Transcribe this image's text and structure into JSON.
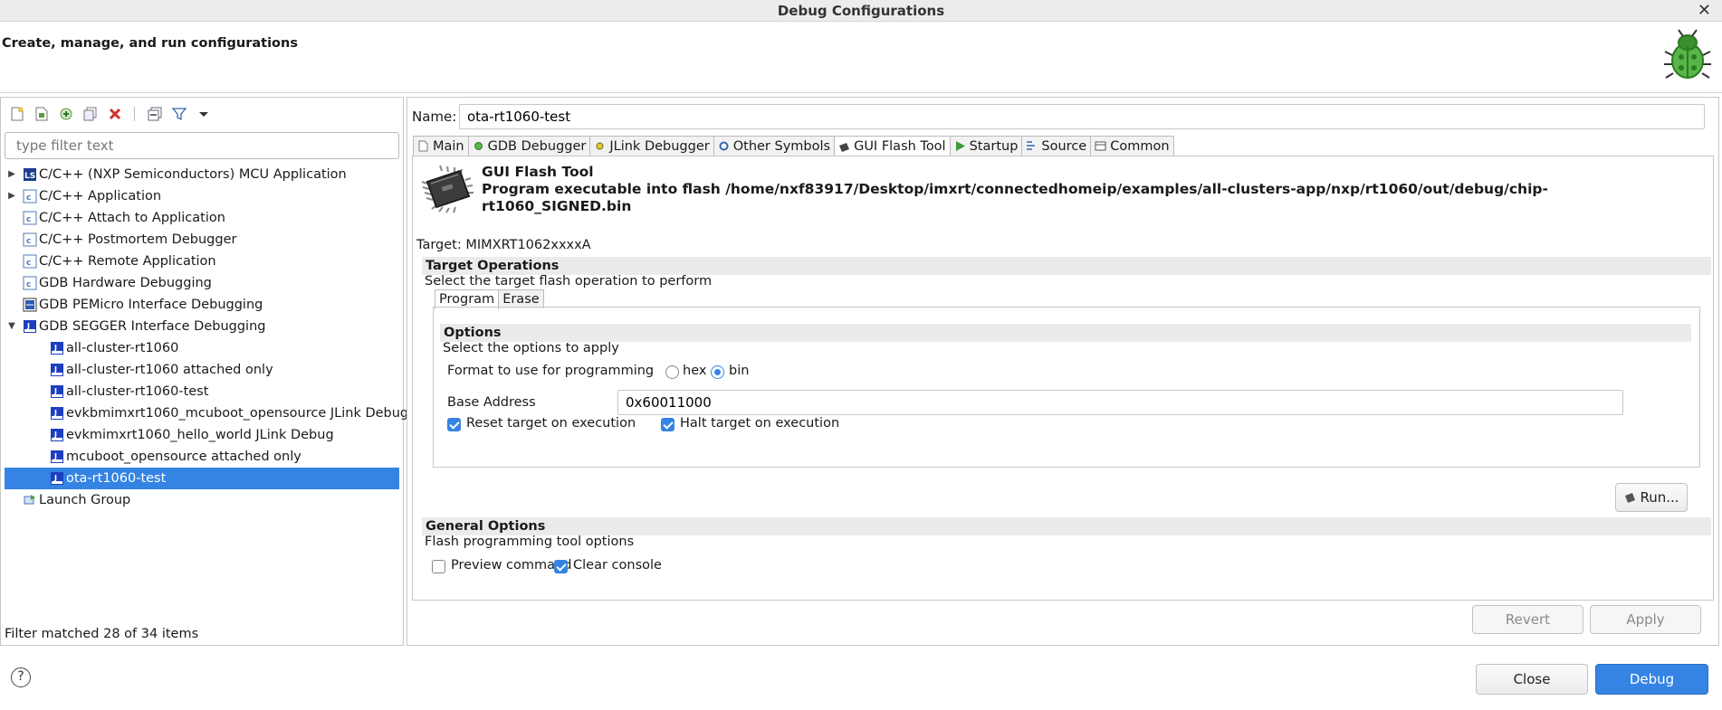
{
  "window": {
    "title": "Debug Configurations",
    "close_glyph": "✕"
  },
  "header": {
    "subtitle": "Create, manage, and run configurations",
    "icon": "bug-icon"
  },
  "left_panel": {
    "toolbar": [
      "new-configuration-icon",
      "new-prototype-icon",
      "export-icon",
      "duplicate-icon",
      "delete-icon",
      "collapse-all-icon",
      "filter-icon",
      "view-menu-icon"
    ],
    "filter_placeholder": "type filter text",
    "tree": [
      {
        "label": "C/C++ (NXP Semiconductors) MCU Application",
        "level": 0,
        "twisty": "▶",
        "icon": "ls"
      },
      {
        "label": "C/C++ Application",
        "level": 0,
        "twisty": "▶",
        "icon": "c"
      },
      {
        "label": "C/C++ Attach to Application",
        "level": 0,
        "twisty": "",
        "icon": "c"
      },
      {
        "label": "C/C++ Postmortem Debugger",
        "level": 0,
        "twisty": "",
        "icon": "c"
      },
      {
        "label": "C/C++ Remote Application",
        "level": 0,
        "twisty": "",
        "icon": "c"
      },
      {
        "label": "GDB Hardware Debugging",
        "level": 0,
        "twisty": "",
        "icon": "c"
      },
      {
        "label": "GDB PEMicro Interface Debugging",
        "level": 0,
        "twisty": "",
        "icon": "pe"
      },
      {
        "label": "GDB SEGGER Interface Debugging",
        "level": 0,
        "twisty": "▼",
        "icon": "j"
      },
      {
        "label": "all-cluster-rt1060",
        "level": 1,
        "twisty": "",
        "icon": "j"
      },
      {
        "label": "all-cluster-rt1060 attached only",
        "level": 1,
        "twisty": "",
        "icon": "j"
      },
      {
        "label": "all-cluster-rt1060-test",
        "level": 1,
        "twisty": "",
        "icon": "j"
      },
      {
        "label": "evkbmimxrt1060_mcuboot_opensource JLink Debug",
        "level": 1,
        "twisty": "",
        "icon": "j"
      },
      {
        "label": "evkmimxrt1060_hello_world JLink Debug",
        "level": 1,
        "twisty": "",
        "icon": "j"
      },
      {
        "label": "mcuboot_opensource attached only",
        "level": 1,
        "twisty": "",
        "icon": "j"
      },
      {
        "label": "ota-rt1060-test",
        "level": 1,
        "twisty": "",
        "icon": "j",
        "selected": true
      },
      {
        "label": "Launch Group",
        "level": 0,
        "twisty": "",
        "icon": "launch"
      }
    ],
    "filter_status": "Filter matched 28 of 34 items"
  },
  "right_panel": {
    "name_label": "Name:",
    "name_value": "ota-rt1060-test",
    "tabs": [
      {
        "label": "Main",
        "icon": "main-tab-icon"
      },
      {
        "label": "GDB Debugger",
        "icon": "debugger-tab-icon"
      },
      {
        "label": "JLink Debugger",
        "icon": "jlink-tab-icon"
      },
      {
        "label": "Other Symbols",
        "icon": "symbols-tab-icon"
      },
      {
        "label": "GUI Flash Tool",
        "icon": "flash-tab-icon",
        "active": true
      },
      {
        "label": "Startup",
        "icon": "startup-tab-icon"
      },
      {
        "label": "Source",
        "icon": "source-tab-icon"
      },
      {
        "label": "Common",
        "icon": "common-tab-icon"
      }
    ],
    "gui_flash": {
      "title": "GUI Flash Tool",
      "description": "Program executable into flash /home/nxf83917/Desktop/imxrt/connectedhomeip/examples/all-clusters-app/nxp/rt1060/out/debug/chip-rt1060_SIGNED.bin",
      "target": "Target: MIMXRT1062xxxxA",
      "target_operations": {
        "heading": "Target Operations",
        "description": "Select the target flash operation to perform",
        "subtabs": [
          "Program",
          "Erase"
        ],
        "options_heading": "Options",
        "options_description": "Select the options to apply",
        "format_label": "Format to use for programming",
        "format_options": [
          "hex",
          "bin"
        ],
        "format_selected": "bin",
        "base_address_label": "Base Address",
        "base_address_value": "0x60011000",
        "reset_label": "Reset target on execution",
        "reset_checked": true,
        "halt_label": "Halt target on execution",
        "halt_checked": true,
        "run_label": "Run..."
      },
      "general_options": {
        "heading": "General Options",
        "description": "Flash programming tool options",
        "preview_label": "Preview command",
        "preview_checked": false,
        "clear_label": "Clear console",
        "clear_checked": true
      }
    },
    "revert_label": "Revert",
    "apply_label": "Apply"
  },
  "footer": {
    "help_glyph": "?",
    "close_label": "Close",
    "debug_label": "Debug"
  },
  "colors": {
    "accent": "#3584e4",
    "section_bg": "#ebebeb"
  }
}
